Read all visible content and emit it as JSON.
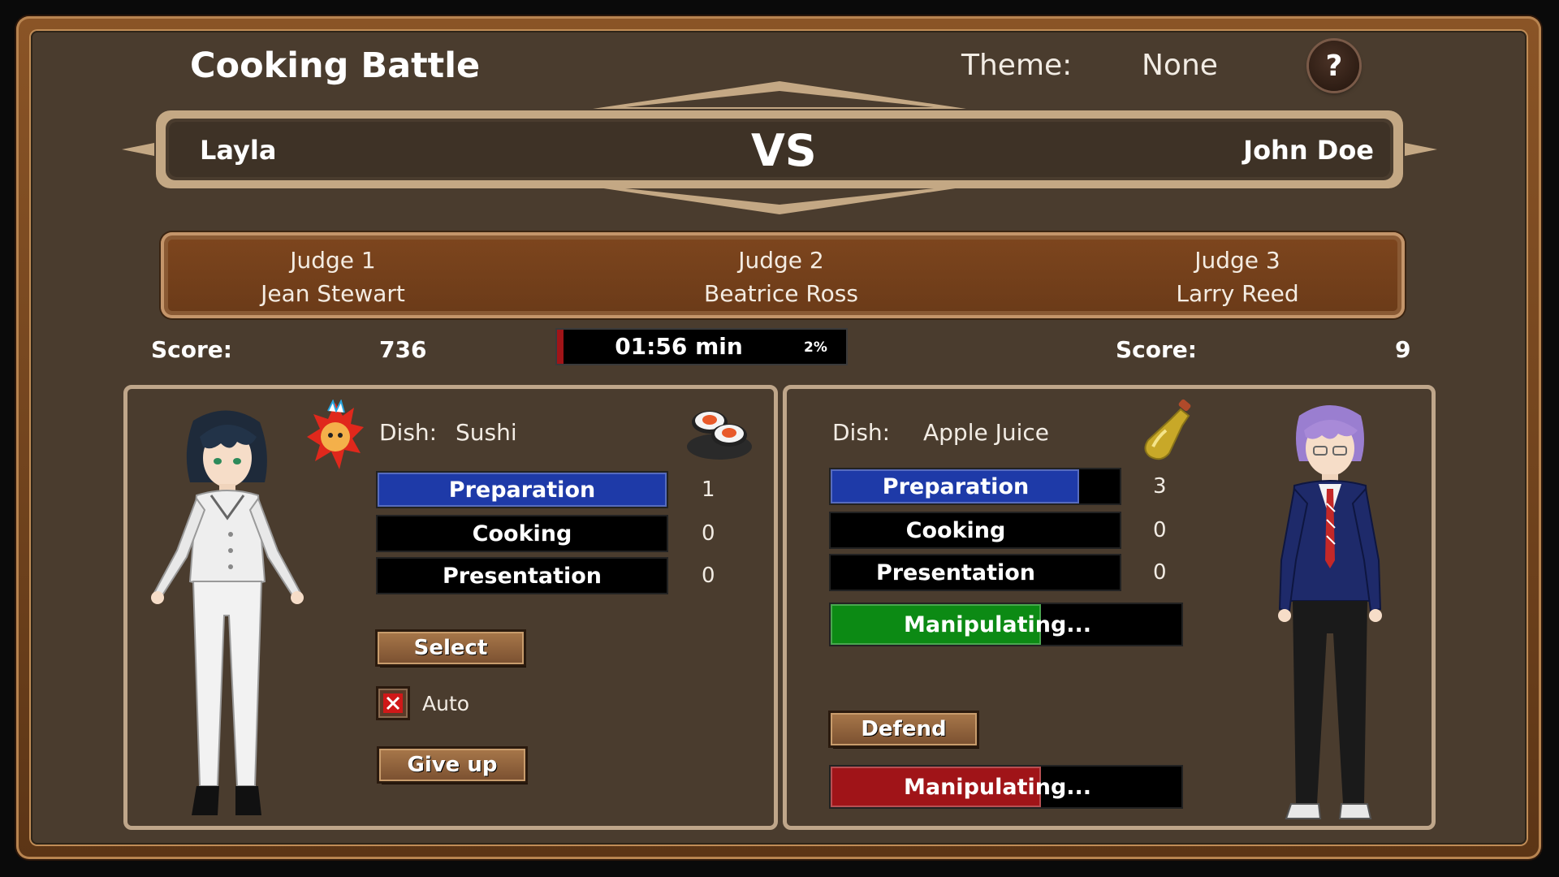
{
  "header": {
    "title": "Cooking Battle",
    "theme_label": "Theme:",
    "theme_value": "None",
    "help_label": "?"
  },
  "versus": {
    "player1": "Layla",
    "vs": "VS",
    "player2": "John Doe"
  },
  "judges": [
    {
      "title": "Judge 1",
      "name": "Jean Stewart"
    },
    {
      "title": "Judge 2",
      "name": "Beatrice Ross"
    },
    {
      "title": "Judge 3",
      "name": "Larry Reed"
    }
  ],
  "scores": {
    "label": "Score:",
    "player1": "736",
    "player2": "9"
  },
  "timer": {
    "text": "01:56 min",
    "percent_label": "2%",
    "progress": 0.02,
    "fill_color": "#a01418"
  },
  "left_panel": {
    "dish_label": "Dish:",
    "dish_value": "Sushi",
    "dish_icon": "sushi-icon",
    "chef_badge_icon": "fire-chef-badge-icon",
    "stages": [
      {
        "label": "Preparation",
        "count": "1",
        "progress": 1.0,
        "color": "#1e3aa8"
      },
      {
        "label": "Cooking",
        "count": "0",
        "progress": 0.0,
        "color": "#1e3aa8"
      },
      {
        "label": "Presentation",
        "count": "0",
        "progress": 0.0,
        "color": "#1e3aa8"
      }
    ],
    "select_label": "Select",
    "auto_label": "Auto",
    "auto_checked": false,
    "give_up_label": "Give up"
  },
  "right_panel": {
    "dish_label": "Dish:",
    "dish_value": "Apple Juice",
    "dish_icon": "juice-bottle-icon",
    "stages": [
      {
        "label": "Preparation",
        "count": "3",
        "progress": 0.86,
        "color": "#1e3aa8"
      },
      {
        "label": "Cooking",
        "count": "0",
        "progress": 0.0,
        "color": "#1e3aa8"
      },
      {
        "label": "Presentation",
        "count": "0",
        "progress": 0.0,
        "color": "#1e3aa8"
      }
    ],
    "manipulate_top": {
      "label": "Manipulating...",
      "progress": 0.6,
      "color": "#0c8a14"
    },
    "defend_label": "Defend",
    "manipulate_bottom": {
      "label": "Manipulating...",
      "progress": 0.6,
      "color": "#a01418"
    }
  }
}
